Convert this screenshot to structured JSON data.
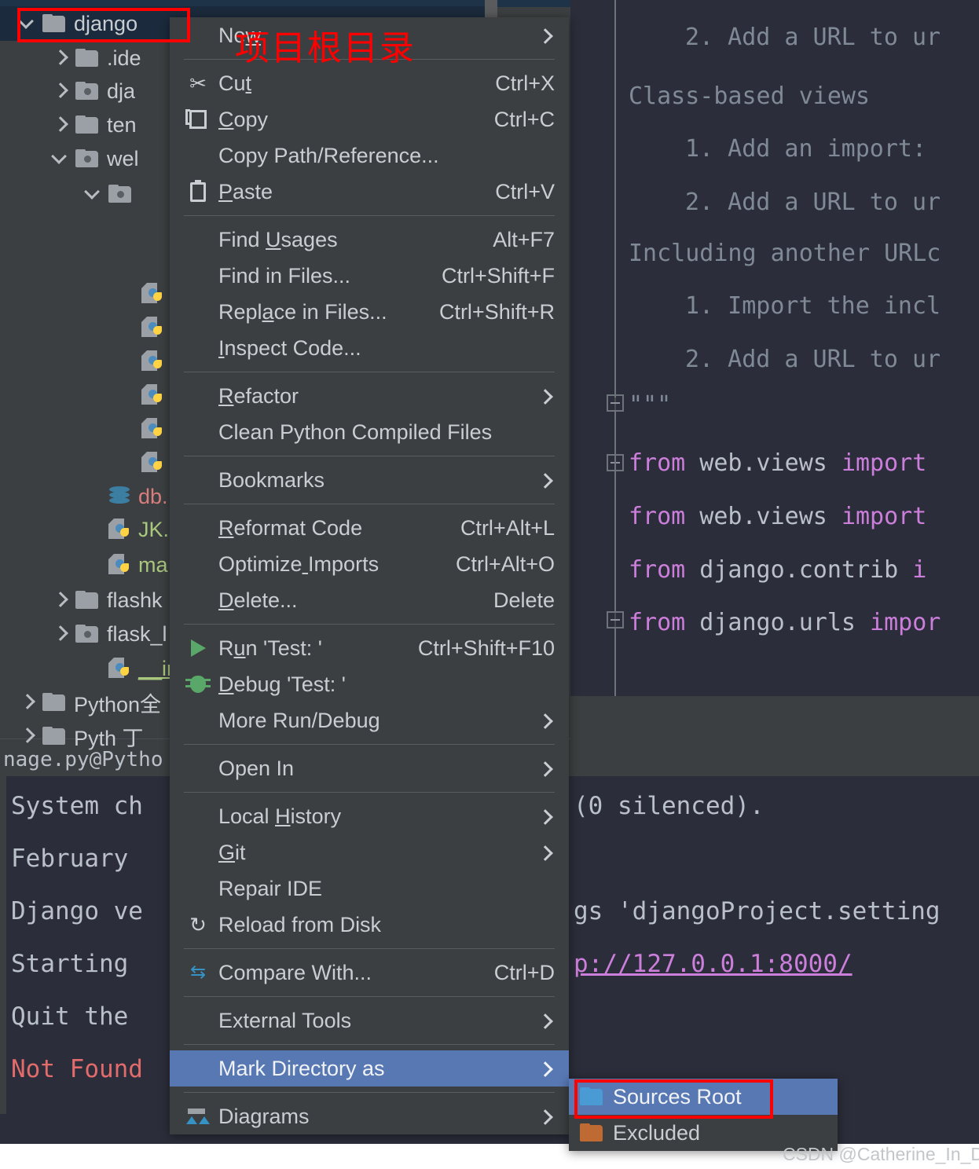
{
  "annotation": {
    "chinese_label": "项目根目录",
    "accent_color": "#ff0000"
  },
  "watermark": "CSDN @Catherine_In_Data",
  "project_tree": {
    "rows": [
      {
        "label": "django",
        "icon": "folder-icon",
        "chevron": "down",
        "indent": 0,
        "selected": true
      },
      {
        "label": ".ide",
        "icon": "folder-icon",
        "chevron": "right",
        "indent": 1,
        "selected": false
      },
      {
        "label": "dja",
        "icon": "module-folder-icon",
        "chevron": "right",
        "indent": 1,
        "selected": false
      },
      {
        "label": "ten",
        "icon": "folder-icon",
        "chevron": "right",
        "indent": 1,
        "selected": false
      },
      {
        "label": "wel",
        "icon": "module-folder-icon",
        "chevron": "down",
        "indent": 1,
        "selected": false
      },
      {
        "label": "",
        "icon": "module-folder-icon",
        "chevron": "down",
        "indent": 2,
        "selected": false
      },
      {
        "label": "",
        "icon": "python-file-icon",
        "chevron": "none",
        "indent": 3,
        "selected": false
      },
      {
        "label": "",
        "icon": "python-file-icon",
        "chevron": "none",
        "indent": 3,
        "selected": false
      },
      {
        "label": "",
        "icon": "python-file-icon",
        "chevron": "none",
        "indent": 3,
        "selected": false
      },
      {
        "label": "",
        "icon": "python-file-icon",
        "chevron": "none",
        "indent": 3,
        "selected": false
      },
      {
        "label": "",
        "icon": "python-file-icon",
        "chevron": "none",
        "indent": 3,
        "selected": false
      },
      {
        "label": "",
        "icon": "python-file-icon",
        "chevron": "none",
        "indent": 3,
        "selected": false
      },
      {
        "label": "db.",
        "icon": "database-icon",
        "chevron": "none",
        "indent": 2,
        "selected": false,
        "color": "red"
      },
      {
        "label": "JK.p",
        "icon": "python-file-icon",
        "chevron": "none",
        "indent": 2,
        "selected": false,
        "color": "green"
      },
      {
        "label": "ma",
        "icon": "python-file-icon",
        "chevron": "none",
        "indent": 2,
        "selected": false,
        "color": "green"
      },
      {
        "label": "flashk",
        "icon": "folder-icon",
        "chevron": "right",
        "indent": 1,
        "selected": false
      },
      {
        "label": "flask_l",
        "icon": "module-folder-icon",
        "chevron": "right",
        "indent": 1,
        "selected": false
      },
      {
        "label": "__init_",
        "icon": "python-file-icon",
        "chevron": "none",
        "indent": 2,
        "selected": false,
        "color": "greenu"
      },
      {
        "label": "Python全",
        "icon": "folder-icon",
        "chevron": "right",
        "indent": 0,
        "selected": false
      },
      {
        "label": "Pyth  丁",
        "icon": "folder-icon",
        "chevron": "right",
        "indent": 0,
        "selected": false
      }
    ]
  },
  "status_bar": {
    "text": "nage.py@Pytho"
  },
  "context_menu": {
    "items": [
      {
        "type": "item",
        "label": "New",
        "mnemonic_index": 2,
        "accel": "",
        "arrow": true,
        "icon": ""
      },
      {
        "type": "separator"
      },
      {
        "type": "item",
        "label": "Cut",
        "mnemonic_index": 2,
        "accel": "Ctrl+X",
        "arrow": false,
        "icon": "scissors-icon"
      },
      {
        "type": "item",
        "label": "Copy",
        "mnemonic_index": 0,
        "accel": "Ctrl+C",
        "arrow": false,
        "icon": "copy-icon"
      },
      {
        "type": "item",
        "label": "Copy Path/Reference...",
        "mnemonic_index": -1,
        "accel": "",
        "arrow": false,
        "icon": ""
      },
      {
        "type": "item",
        "label": "Paste",
        "mnemonic_index": 0,
        "accel": "Ctrl+V",
        "arrow": false,
        "icon": "paste-icon"
      },
      {
        "type": "separator"
      },
      {
        "type": "item",
        "label": "Find Usages",
        "mnemonic_index": 5,
        "accel": "Alt+F7",
        "arrow": false,
        "icon": ""
      },
      {
        "type": "item",
        "label": "Find in Files...",
        "mnemonic_index": -1,
        "accel": "Ctrl+Shift+F",
        "arrow": false,
        "icon": ""
      },
      {
        "type": "item",
        "label": "Replace in Files...",
        "mnemonic_index": 4,
        "accel": "Ctrl+Shift+R",
        "arrow": false,
        "icon": ""
      },
      {
        "type": "item",
        "label": "Inspect Code...",
        "mnemonic_index": 0,
        "accel": "",
        "arrow": false,
        "icon": ""
      },
      {
        "type": "separator"
      },
      {
        "type": "item",
        "label": "Refactor",
        "mnemonic_index": 0,
        "accel": "",
        "arrow": true,
        "icon": ""
      },
      {
        "type": "item",
        "label": "Clean Python Compiled Files",
        "mnemonic_index": -1,
        "accel": "",
        "arrow": false,
        "icon": ""
      },
      {
        "type": "separator"
      },
      {
        "type": "item",
        "label": "Bookmarks",
        "mnemonic_index": -1,
        "accel": "",
        "arrow": true,
        "icon": ""
      },
      {
        "type": "separator"
      },
      {
        "type": "item",
        "label": "Reformat Code",
        "mnemonic_index": 0,
        "accel": "Ctrl+Alt+L",
        "arrow": false,
        "icon": ""
      },
      {
        "type": "item",
        "label": "Optimize Imports",
        "mnemonic_index": 8,
        "accel": "Ctrl+Alt+O",
        "arrow": false,
        "icon": ""
      },
      {
        "type": "item",
        "label": "Delete...",
        "mnemonic_index": 0,
        "accel": "Delete",
        "arrow": false,
        "icon": ""
      },
      {
        "type": "separator"
      },
      {
        "type": "item",
        "label": "Run 'Test: '",
        "mnemonic_index": 1,
        "accel": "Ctrl+Shift+F10",
        "arrow": false,
        "icon": "run-icon"
      },
      {
        "type": "item",
        "label": "Debug 'Test: '",
        "mnemonic_index": 0,
        "accel": "",
        "arrow": false,
        "icon": "debug-icon"
      },
      {
        "type": "item",
        "label": "More Run/Debug",
        "mnemonic_index": -1,
        "accel": "",
        "arrow": true,
        "icon": ""
      },
      {
        "type": "separator"
      },
      {
        "type": "item",
        "label": "Open In",
        "mnemonic_index": -1,
        "accel": "",
        "arrow": true,
        "icon": ""
      },
      {
        "type": "separator"
      },
      {
        "type": "item",
        "label": "Local History",
        "mnemonic_index": 6,
        "accel": "",
        "arrow": true,
        "icon": ""
      },
      {
        "type": "item",
        "label": "Git",
        "mnemonic_index": 0,
        "accel": "",
        "arrow": true,
        "icon": ""
      },
      {
        "type": "item",
        "label": "Repair IDE",
        "mnemonic_index": -1,
        "accel": "",
        "arrow": false,
        "icon": ""
      },
      {
        "type": "item",
        "label": "Reload from Disk",
        "mnemonic_index": -1,
        "accel": "",
        "arrow": false,
        "icon": "reload-icon"
      },
      {
        "type": "separator"
      },
      {
        "type": "item",
        "label": "Compare With...",
        "mnemonic_index": -1,
        "accel": "Ctrl+D",
        "arrow": false,
        "icon": "compare-icon"
      },
      {
        "type": "separator"
      },
      {
        "type": "item",
        "label": "External Tools",
        "mnemonic_index": -1,
        "accel": "",
        "arrow": true,
        "icon": ""
      },
      {
        "type": "separator"
      },
      {
        "type": "item",
        "label": "Mark Directory as",
        "mnemonic_index": -1,
        "accel": "",
        "arrow": true,
        "icon": "",
        "highlighted": true
      },
      {
        "type": "separator"
      },
      {
        "type": "item",
        "label": "Diagrams",
        "mnemonic_index": -1,
        "accel": "",
        "arrow": true,
        "icon": "diagram-icon"
      }
    ]
  },
  "submenu": {
    "title": "Mark Directory as",
    "items": [
      {
        "label": "Sources Root",
        "folder_color": "#4a9ad4",
        "highlighted": true
      },
      {
        "label": "Excluded",
        "folder_color": "#bf6a32",
        "highlighted": false
      }
    ]
  },
  "editor": {
    "lines": [
      {
        "text": "2. Add a URL to ur",
        "indent": 1,
        "style": "comment"
      },
      {
        "text": "Class-based views",
        "indent": 0,
        "style": "comment"
      },
      {
        "text": "1. Add an import:",
        "indent": 1,
        "style": "comment"
      },
      {
        "text": "2. Add a URL to ur",
        "indent": 1,
        "style": "comment"
      },
      {
        "text": "Including another URLc",
        "indent": 0,
        "style": "comment"
      },
      {
        "text": "1. Import the incl",
        "indent": 1,
        "style": "comment"
      },
      {
        "text": "2. Add a URL to ur",
        "indent": 1,
        "style": "comment"
      },
      {
        "text": "\"\"\"",
        "indent": 0,
        "style": "comment"
      },
      {
        "text": "from web.views import",
        "indent": 0,
        "style": "code"
      },
      {
        "text": "from web.views import",
        "indent": 0,
        "style": "code"
      },
      {
        "text": "from django.contrib i",
        "indent": 0,
        "style": "code"
      },
      {
        "text": "from django.urls impor",
        "indent": 0,
        "style": "code"
      }
    ]
  },
  "console": {
    "left_lines": [
      "System ch",
      "February",
      "Django ve",
      "Starting",
      "Quit the",
      "Not Found"
    ],
    "right_lines": [
      "(0 silenced).",
      "gs 'djangoProject.setting",
      "p://127.0.0.1:8000/"
    ]
  }
}
